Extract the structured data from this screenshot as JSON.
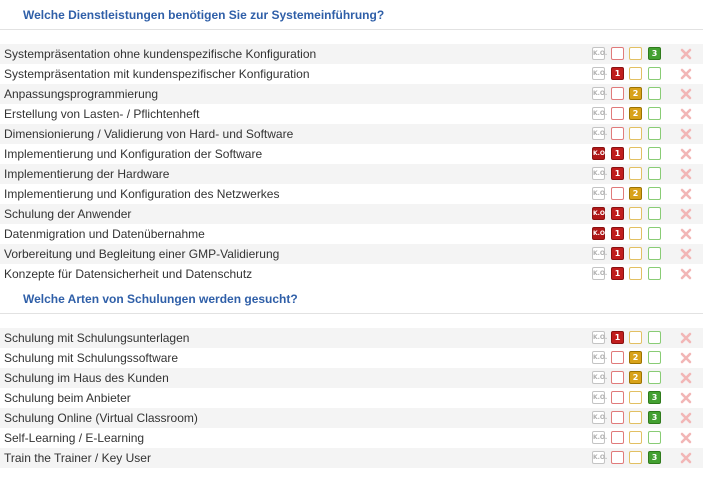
{
  "colors": {
    "header_text": "#2f5fa8",
    "row_alt_bg": "#f4f4f4",
    "red": "#c01d1d",
    "yellow": "#d8a21a",
    "green": "#43a031",
    "delete_icon": "#f2b6b6"
  },
  "icons": {
    "delete": "x-icon",
    "knockout": "ko-badge-icon"
  },
  "ko_label": "K.O.",
  "sections": [
    {
      "title": "Welche Dienstleistungen benötigen Sie zur Systemeinführung?",
      "items": [
        {
          "label": "Systempräsentation ohne kundenspezifische Konfiguration",
          "ko": false,
          "rating": 3
        },
        {
          "label": "Systempräsentation mit kundenspezifischer Konfiguration",
          "ko": false,
          "rating": 1
        },
        {
          "label": "Anpassungsprogrammierung",
          "ko": false,
          "rating": 2
        },
        {
          "label": "Erstellung von Lasten- / Pflichtenheft",
          "ko": false,
          "rating": 2
        },
        {
          "label": "Dimensionierung / Validierung von Hard- und Software",
          "ko": false,
          "rating": 0
        },
        {
          "label": "Implementierung und Konfiguration der Software",
          "ko": true,
          "rating": 1
        },
        {
          "label": "Implementierung der Hardware",
          "ko": false,
          "rating": 1
        },
        {
          "label": "Implementierung und Konfiguration des Netzwerkes",
          "ko": false,
          "rating": 2
        },
        {
          "label": "Schulung der Anwender",
          "ko": true,
          "rating": 1
        },
        {
          "label": "Datenmigration und Datenübernahme",
          "ko": true,
          "rating": 1
        },
        {
          "label": "Vorbereitung und Begleitung einer GMP-Validierung",
          "ko": false,
          "rating": 1
        },
        {
          "label": "Konzepte für Datensicherheit und Datenschutz",
          "ko": false,
          "rating": 1
        }
      ]
    },
    {
      "title": "Welche Arten von Schulungen werden gesucht?",
      "items": [
        {
          "label": "Schulung mit Schulungsunterlagen",
          "ko": false,
          "rating": 1
        },
        {
          "label": "Schulung mit Schulungssoftware",
          "ko": false,
          "rating": 2
        },
        {
          "label": "Schulung im Haus des Kunden",
          "ko": false,
          "rating": 2
        },
        {
          "label": "Schulung beim Anbieter",
          "ko": false,
          "rating": 3
        },
        {
          "label": "Schulung Online (Virtual Classroom)",
          "ko": false,
          "rating": 3
        },
        {
          "label": "Self-Learning / E-Learning",
          "ko": false,
          "rating": 0
        },
        {
          "label": "Train the Trainer / Key User",
          "ko": false,
          "rating": 3
        }
      ]
    }
  ]
}
